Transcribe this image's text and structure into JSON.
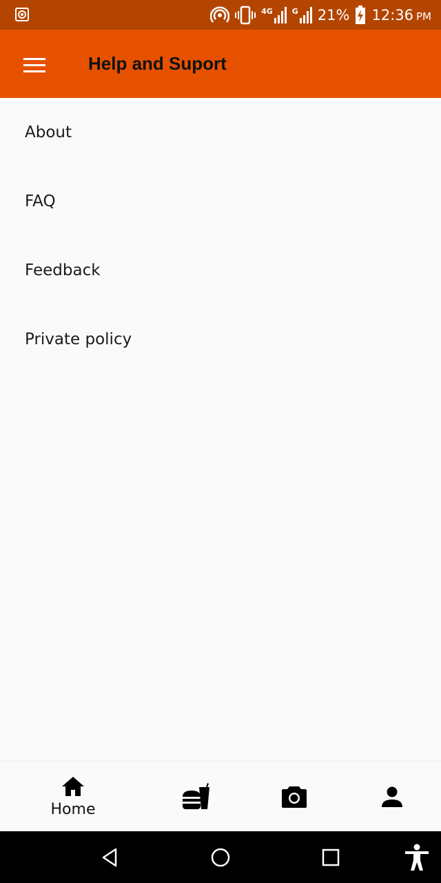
{
  "status_bar": {
    "network_4g": "4G",
    "network_g": "G",
    "battery": "21%",
    "time": "12:36",
    "ampm": "PM"
  },
  "app_bar": {
    "title": "Help and Suport",
    "color": "#e65100"
  },
  "menu_items": [
    {
      "label": "About"
    },
    {
      "label": "FAQ"
    },
    {
      "label": "Feedback"
    },
    {
      "label": "Private policy"
    }
  ],
  "bottom_nav": {
    "items": [
      {
        "icon": "home-icon",
        "label": "Home"
      },
      {
        "icon": "fastfood-icon"
      },
      {
        "icon": "camera-icon"
      },
      {
        "icon": "person-icon"
      }
    ]
  },
  "system_nav": {
    "buttons": [
      "back-icon",
      "home-circle-icon",
      "recents-icon",
      "accessibility-icon"
    ]
  }
}
